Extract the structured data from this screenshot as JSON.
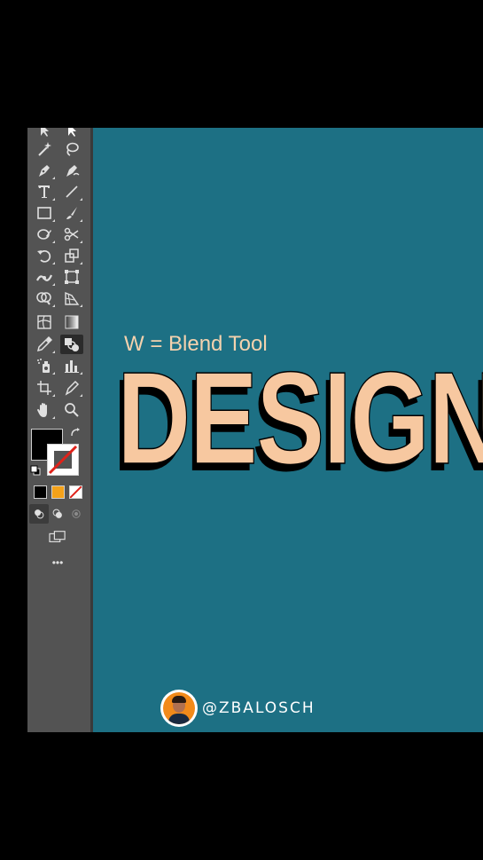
{
  "toolbar": {
    "tools": [
      {
        "name": "magic-wand-icon",
        "row": 0,
        "col": 0
      },
      {
        "name": "lasso-icon",
        "row": 0,
        "col": 1
      },
      {
        "name": "pen-icon",
        "row": 1,
        "col": 0
      },
      {
        "name": "curvature-pen-icon",
        "row": 1,
        "col": 1
      },
      {
        "name": "type-icon",
        "row": 2,
        "col": 0
      },
      {
        "name": "line-segment-icon",
        "row": 2,
        "col": 1
      },
      {
        "name": "rectangle-icon",
        "row": 3,
        "col": 0
      },
      {
        "name": "paintbrush-icon",
        "row": 3,
        "col": 1
      },
      {
        "name": "shaper-icon",
        "row": 4,
        "col": 0
      },
      {
        "name": "scissors-icon",
        "row": 4,
        "col": 1
      },
      {
        "name": "rotate-icon",
        "row": 5,
        "col": 0
      },
      {
        "name": "scale-icon",
        "row": 5,
        "col": 1
      },
      {
        "name": "width-icon",
        "row": 6,
        "col": 0
      },
      {
        "name": "free-transform-icon",
        "row": 6,
        "col": 1
      },
      {
        "name": "shape-builder-icon",
        "row": 7,
        "col": 0
      },
      {
        "name": "perspective-grid-icon",
        "row": 7,
        "col": 1
      },
      {
        "name": "mesh-icon",
        "row": 8,
        "col": 0
      },
      {
        "name": "gradient-icon",
        "row": 8,
        "col": 1
      },
      {
        "name": "eyedropper-icon",
        "row": 9,
        "col": 0
      },
      {
        "name": "blend-icon",
        "row": 9,
        "col": 1,
        "selected": true
      },
      {
        "name": "symbol-sprayer-icon",
        "row": 10,
        "col": 0
      },
      {
        "name": "column-graph-icon",
        "row": 10,
        "col": 1
      },
      {
        "name": "artboard-icon",
        "row": 11,
        "col": 0
      },
      {
        "name": "slice-icon",
        "row": 11,
        "col": 1
      },
      {
        "name": "hand-icon",
        "row": 12,
        "col": 0
      },
      {
        "name": "zoom-icon",
        "row": 12,
        "col": 1
      }
    ],
    "fill_color": "#000000",
    "stroke_color": "none",
    "swatch_colors": [
      "#000000",
      "#f4a21a",
      "none"
    ],
    "more_label": "•••"
  },
  "canvas": {
    "background": "#1d7084",
    "hint_text": "W = Blend Tool",
    "headline": "DESIGN",
    "headline_color": "#f7c8a0"
  },
  "watermark": {
    "handle": "@ZBALOSCH"
  }
}
